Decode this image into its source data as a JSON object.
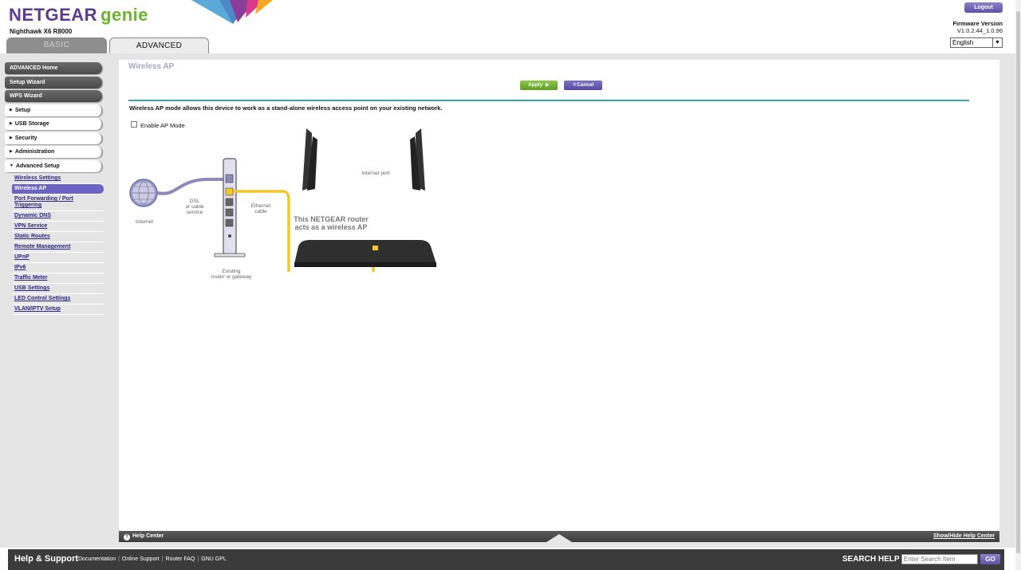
{
  "header": {
    "logo_primary": "NETGEAR",
    "logo_secondary": "genie",
    "model": "Nighthawk X6 R8000",
    "tabs": [
      {
        "label": "BASIC",
        "active": false
      },
      {
        "label": "ADVANCED",
        "active": true
      }
    ],
    "logout_label": "Logout",
    "firmware_label": "Firmware Version",
    "firmware_value": "V1.0.2.44_1.0.96",
    "language_selected": "English"
  },
  "sidebar": {
    "dark_items": [
      "ADVANCED Home",
      "Setup Wizard",
      "WPS Wizard"
    ],
    "sections": [
      {
        "label": "Setup",
        "expanded": false
      },
      {
        "label": "USB Storage",
        "expanded": false
      },
      {
        "label": "Security",
        "expanded": false
      },
      {
        "label": "Administration",
        "expanded": false
      },
      {
        "label": "Advanced Setup",
        "expanded": true
      }
    ],
    "submenu": [
      {
        "label": "Wireless Settings",
        "active": false
      },
      {
        "label": "Wireless AP",
        "active": true
      },
      {
        "label": "Port Forwarding / Port Triggering",
        "active": false
      },
      {
        "label": "Dynamic DNS",
        "active": false
      },
      {
        "label": "VPN Service",
        "active": false
      },
      {
        "label": "Static Routes",
        "active": false
      },
      {
        "label": "Remote Management",
        "active": false
      },
      {
        "label": "UPnP",
        "active": false
      },
      {
        "label": "IPv6",
        "active": false
      },
      {
        "label": "Traffic Meter",
        "active": false
      },
      {
        "label": "USB Settings",
        "active": false
      },
      {
        "label": "LED Control Settings",
        "active": false
      },
      {
        "label": "VLAN/IPTV Setup",
        "active": false
      }
    ]
  },
  "main": {
    "title": "Wireless AP",
    "apply_label": "Apply",
    "cancel_label": "Cancel",
    "description": "Wireless AP mode allows this device to work as a stand-alone wireless access point on your existing network.",
    "checkbox_label": "Enable AP Mode",
    "checkbox_checked": false,
    "diagram": {
      "internet": "Internet",
      "dsl": "DSL\nor cable\nservice",
      "ethernet": "Ethernet\ncable",
      "internet_port": "Internet port",
      "existing": "Existing\nrouter or gateway",
      "caption": "This NETGEAR router acts as a wireless AP"
    }
  },
  "help": {
    "label": "Help Center",
    "toggle_label": "Show/Hide Help Center"
  },
  "footer": {
    "title": "Help & Support",
    "links": [
      "Documentation",
      "Online Support",
      "Router FAQ",
      "GNU GPL"
    ],
    "search_label": "SEARCH HELP",
    "search_placeholder": "Enter Search Item",
    "go_label": "GO"
  },
  "colors": {
    "brand_purple": "#5d3b8e",
    "brand_green": "#6ab42d",
    "accent_teal": "#3ca6b0",
    "active_menu": "#6b64c4",
    "cable_yellow": "#f2c82a"
  }
}
